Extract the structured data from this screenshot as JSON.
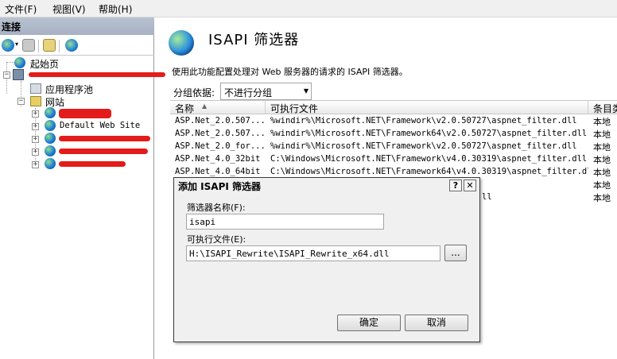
{
  "menu": {
    "file": "文件(F)",
    "view": "视图(V)",
    "help": "帮助(H)"
  },
  "connections": {
    "header": "连接",
    "tree": {
      "start_page": "起始页",
      "app_pools": "应用程序池",
      "sites": "网站",
      "default_site": "Default Web Site"
    }
  },
  "main": {
    "title": "ISAPI 筛选器",
    "description": "使用此功能配置处理对 Web 服务器的请求的 ISAPI 筛选器。",
    "group_by_label": "分组依据:",
    "group_by_value": "不进行分组",
    "table": {
      "columns": [
        "名称",
        "可执行文件",
        "条目类"
      ],
      "rows": [
        {
          "name": "ASP.Net_2.0.507...",
          "exe": "%windir%\\Microsoft.NET\\Framework\\v2.0.50727\\aspnet_filter.dll",
          "type": "本地"
        },
        {
          "name": "ASP.Net_2.0.507...",
          "exe": "%windir%\\Microsoft.NET\\Framework64\\v2.0.50727\\aspnet_filter.dll",
          "type": "本地"
        },
        {
          "name": "ASP.Net_2.0_for...",
          "exe": "%windir%\\Microsoft.NET\\Framework\\v2.0.50727\\aspnet_filter.dll",
          "type": "本地"
        },
        {
          "name": "ASP.Net_4.0_32bit",
          "exe": "C:\\Windows\\Microsoft.NET\\Framework\\v4.0.30319\\aspnet_filter.dll",
          "type": "本地"
        },
        {
          "name": "ASP.Net_4.0_64bit",
          "exe": "C:\\Windows\\Microsoft.NET\\Framework64\\v4.0.30319\\aspnet_filter.dll",
          "type": "本地"
        },
        {
          "name": "",
          "exe": "",
          "type": "本地"
        },
        {
          "name": "",
          "exe": "ll",
          "type": "本地"
        }
      ]
    }
  },
  "dialog": {
    "title": "添加 ISAPI 筛选器",
    "help_btn": "?",
    "close_btn": "✕",
    "filter_name_label": "筛选器名称(F):",
    "filter_name_value": "isapi",
    "exe_label": "可执行文件(E):",
    "exe_value": "H:\\ISAPI_Rewrite\\ISAPI_Rewrite_x64.dll",
    "browse_btn": "...",
    "ok_btn": "确定",
    "cancel_btn": "取消"
  }
}
